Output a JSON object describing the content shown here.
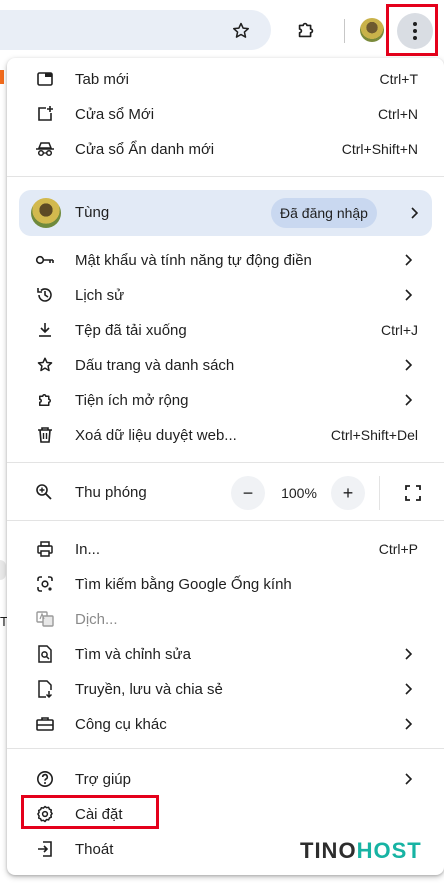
{
  "toolbar": {
    "bookmark_icon": "star-icon",
    "extensions_icon": "puzzle-icon",
    "profile_icon": "avatar",
    "menu_icon": "kebab-menu-icon"
  },
  "menu": {
    "new_tab": {
      "label": "Tab mới",
      "shortcut": "Ctrl+T"
    },
    "new_window": {
      "label": "Cửa sổ Mới",
      "shortcut": "Ctrl+N"
    },
    "incognito": {
      "label": "Cửa sổ Ẩn danh mới",
      "shortcut": "Ctrl+Shift+N"
    },
    "profile": {
      "name": "Tùng",
      "status": "Đã đăng nhập"
    },
    "passwords": {
      "label": "Mật khẩu và tính năng tự động điền"
    },
    "history": {
      "label": "Lịch sử"
    },
    "downloads": {
      "label": "Tệp đã tải xuống",
      "shortcut": "Ctrl+J"
    },
    "bookmarks": {
      "label": "Dấu trang và danh sách"
    },
    "extensions": {
      "label": "Tiện ích mở rộng"
    },
    "clear_data": {
      "label": "Xoá dữ liệu duyệt web...",
      "shortcut": "Ctrl+Shift+Del"
    },
    "zoom": {
      "label": "Thu phóng",
      "value": "100%",
      "minus": "−",
      "plus": "+"
    },
    "print": {
      "label": "In...",
      "shortcut": "Ctrl+P"
    },
    "lens": {
      "label": "Tìm kiếm bằng Google Ống kính"
    },
    "translate": {
      "label": "Dịch..."
    },
    "find_edit": {
      "label": "Tìm và chỉnh sửa"
    },
    "cast_save": {
      "label": "Truyền, lưu và chia sẻ"
    },
    "more_tools": {
      "label": "Công cụ khác"
    },
    "help": {
      "label": "Trợ giúp"
    },
    "settings": {
      "label": "Cài đặt"
    },
    "exit": {
      "label": "Thoát"
    }
  },
  "background": {
    "partial_text": "T"
  },
  "watermark": {
    "part1": "TINO",
    "part2": "HOST"
  },
  "colors": {
    "highlight_box": "#e4001b",
    "profile_bg": "#e2eaf6",
    "logo_accent": "#17b3a3"
  }
}
